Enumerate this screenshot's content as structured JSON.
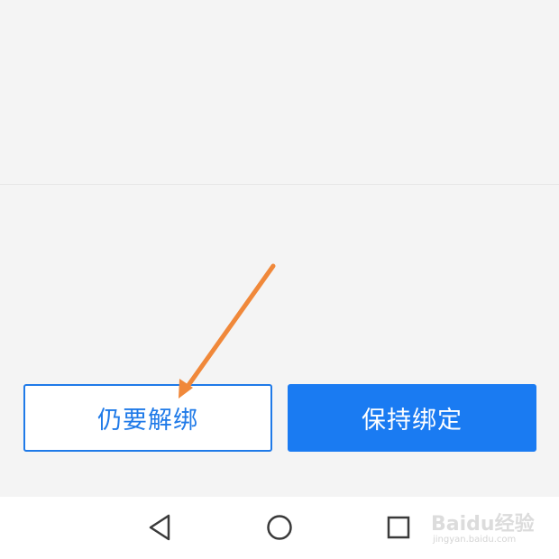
{
  "dialog": {
    "unbind_label": "仍要解绑",
    "keep_label": "保持绑定"
  },
  "navbar": {
    "back_icon": "triangle-back-icon",
    "home_icon": "circle-home-icon",
    "recent_icon": "square-recent-icon"
  },
  "watermark": {
    "logo_text": "Baidu经验",
    "url_text": "jingyan.baidu.com"
  },
  "colors": {
    "background": "#f4f4f4",
    "accent": "#1a7bf2",
    "annotation_arrow": "#f0883a",
    "navbar_bg": "#ffffff"
  }
}
